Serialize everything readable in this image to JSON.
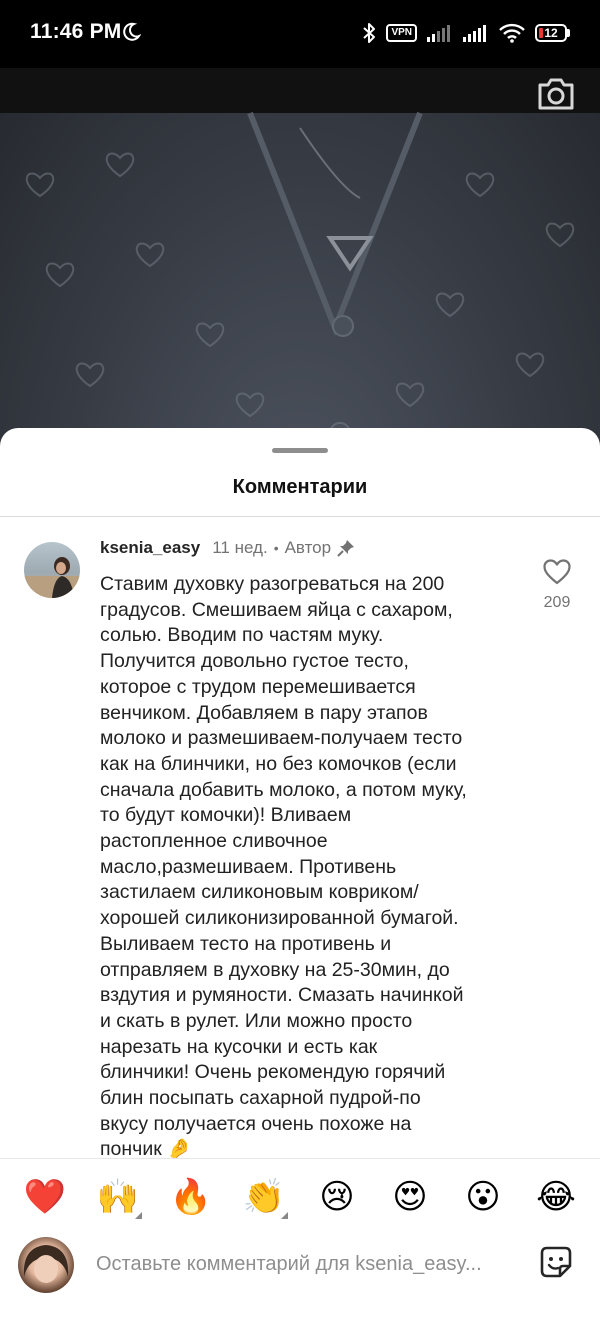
{
  "status_bar": {
    "time": "11:46 PM",
    "vpn": "VPN",
    "battery": "12",
    "battery_color": "#e53935"
  },
  "icons": {
    "moon": "moon-icon",
    "bluetooth": "bluetooth-icon",
    "signal": "signal-icon",
    "wifi": "wifi-icon",
    "camera": "camera-icon",
    "heart": "heart-outline-icon",
    "pin": "pin-icon",
    "sticker": "sticker-icon"
  },
  "sheet": {
    "title": "Комментарии"
  },
  "comment": {
    "username": "ksenia_easy",
    "time": "11 нед.",
    "separator": "•",
    "author_label": "Автор",
    "text": "Ставим духовку разогреваться на 200\nградусов. Смешиваем яйца с сахаром,\nсолью. Вводим по частям муку.\nПолучится довольно густое тесто,\nкоторое с трудом перемешивается\nвенчиком. Добавляем в пару этапов\nмолоко и размешиваем-получаем тесто\nкак на блинчики, но без комочков (если\nсначала добавить молоко, а потом муку,\nто будут комочки)! Вливаем\nрастопленное сливочное\nмасло,размешиваем.  Противень\nзастилаем силиконовым ковриком/\nхорошей силиконизированной бумагой.\nВыливаем тесто на противень и\nотправляем в духовку на 25-30мин, до\nвздутия и румяности. Смазать начинкой\nи скать в рулет. Или можно просто\nнарезать на кусочки и есть как\nблинчики! Очень рекомендую горячий\nблин посыпать сахарной пудрой-по\nвкусу получается очень похоже на\nпончик 🤌",
    "likes": "209"
  },
  "reactions": [
    {
      "emoji": "❤️",
      "name": "red-heart"
    },
    {
      "emoji": "🙌",
      "name": "raising-hands"
    },
    {
      "emoji": "🔥",
      "name": "fire"
    },
    {
      "emoji": "👏",
      "name": "clapping-hands"
    },
    {
      "emoji": "😢",
      "name": "crying-face"
    },
    {
      "emoji": "😍",
      "name": "heart-eyes"
    },
    {
      "emoji": "😮",
      "name": "open-mouth-face"
    },
    {
      "emoji": "😂",
      "name": "tears-of-joy"
    }
  ],
  "input": {
    "placeholder": "Оставьте комментарий для ksenia_easy..."
  }
}
